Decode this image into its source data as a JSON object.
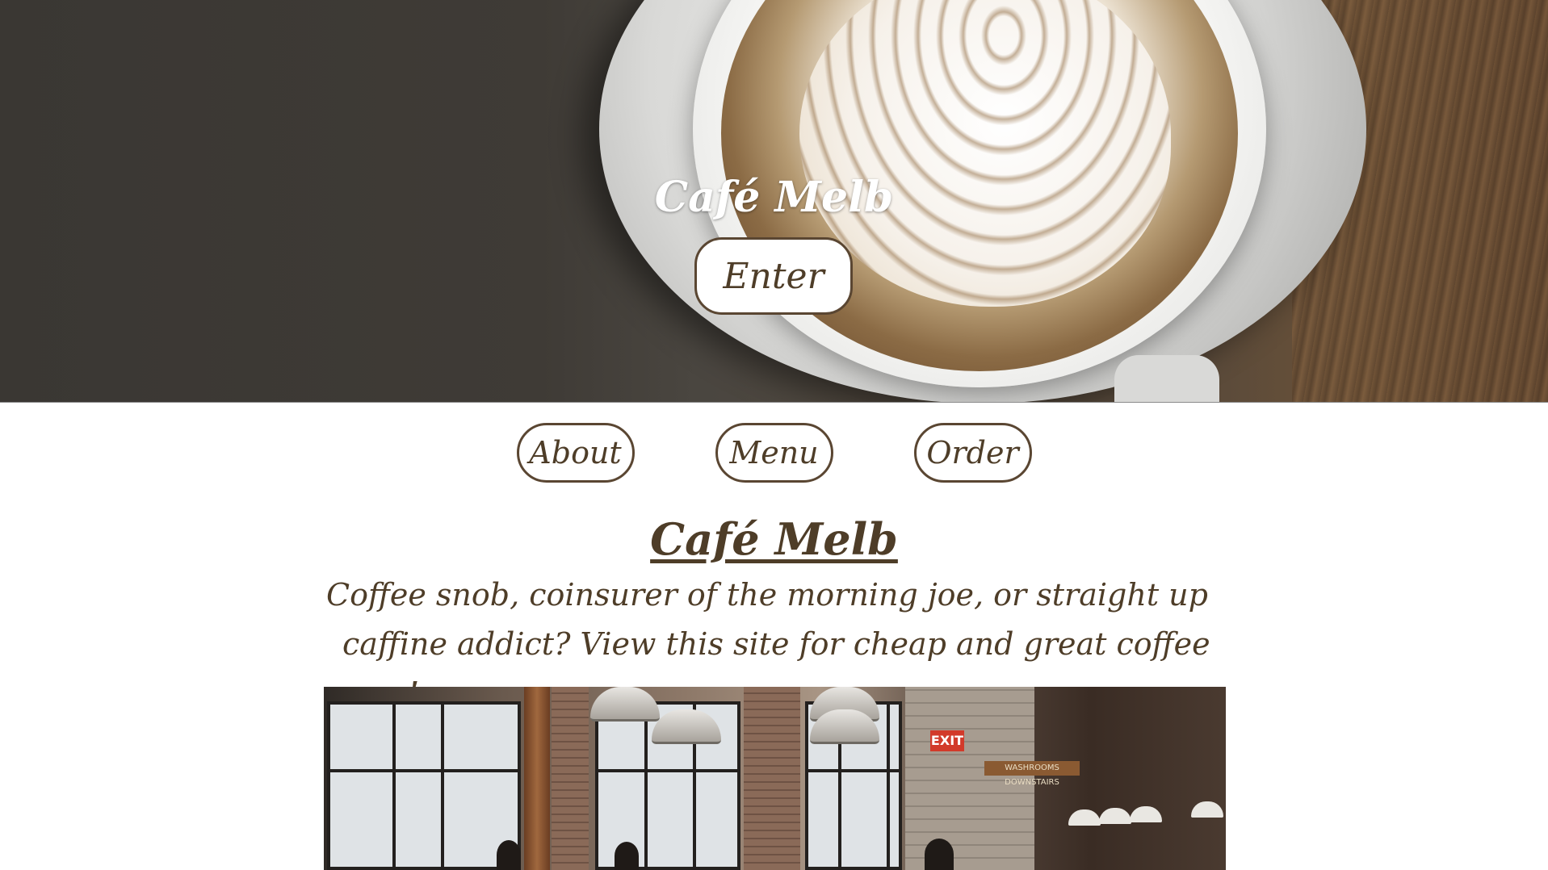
{
  "hero": {
    "title": "Café Melb",
    "enter_label": "Enter"
  },
  "nav": {
    "items": [
      {
        "label": "About"
      },
      {
        "label": "Menu"
      },
      {
        "label": "Order"
      }
    ]
  },
  "main": {
    "title": "Café Melb",
    "tagline_line1": "Coffee snob, coinsurer of the morning joe, or straight up",
    "tagline_line2": "caffine addict? View this site for cheap and great coffee now!"
  },
  "photo": {
    "exit_sign": "EXIT",
    "washroom_sign": "WASHROOMS DOWNSTAIRS"
  },
  "colors": {
    "text_brown": "#4e3d28",
    "border_brown": "#5a4632",
    "background": "#ffffff"
  }
}
